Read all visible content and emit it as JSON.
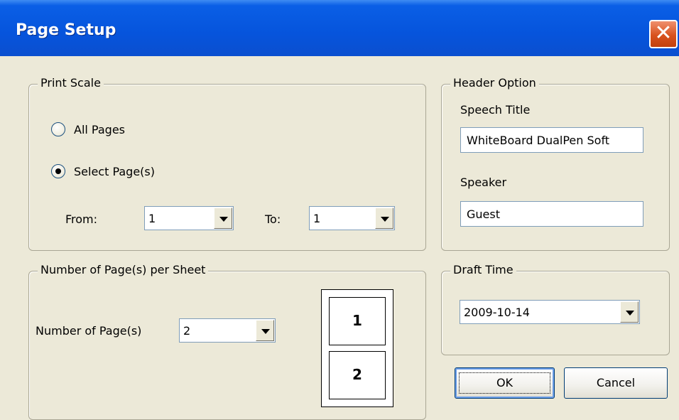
{
  "window": {
    "title": "Page Setup",
    "close_icon": "close-icon"
  },
  "print_scale": {
    "legend": "Print Scale",
    "all_pages_label": "All Pages",
    "select_pages_label": "Select Page(s)",
    "selected": "select_pages",
    "from_label": "From:",
    "from_value": "1",
    "to_label": "To:",
    "to_value": "1"
  },
  "pages_per_sheet": {
    "legend": "Number of Page(s) per Sheet",
    "label": "Number of Page(s)",
    "value": "2",
    "preview": [
      "1",
      "2"
    ]
  },
  "header_option": {
    "legend": "Header Option",
    "speech_title_label": "Speech Title",
    "speech_title_value": "WhiteBoard DualPen Soft",
    "speaker_label": "Speaker",
    "speaker_value": "Guest"
  },
  "draft_time": {
    "legend": "Draft Time",
    "value": "2009-10-14"
  },
  "buttons": {
    "ok": "OK",
    "cancel": "Cancel"
  },
  "colors": {
    "titlebar": "#0654dc",
    "dialog_bg": "#ece9d8",
    "close": "#d8521e"
  }
}
